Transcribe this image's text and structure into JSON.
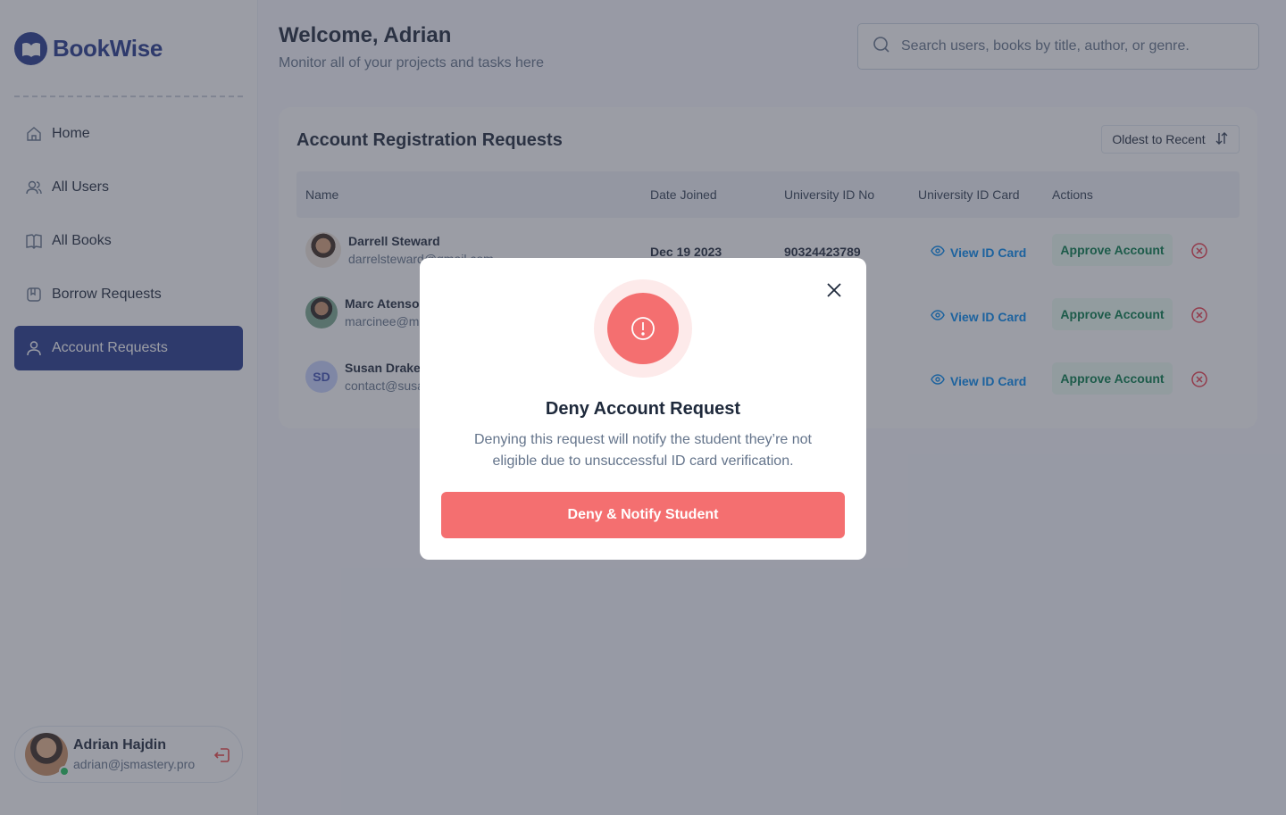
{
  "brand": {
    "name": "BookWise",
    "color": "#25388c"
  },
  "sidebar": {
    "items": [
      {
        "label": "Home",
        "icon": "home-icon"
      },
      {
        "label": "All Users",
        "icon": "users-icon"
      },
      {
        "label": "All Books",
        "icon": "book-icon"
      },
      {
        "label": "Borrow Requests",
        "icon": "bookmark-icon"
      },
      {
        "label": "Account Requests",
        "icon": "user-icon",
        "active": true
      }
    ],
    "user": {
      "name": "Adrian Hajdin",
      "email": "adrian@jsmastery.pro",
      "status": "online"
    }
  },
  "header": {
    "title": "Welcome, Adrian",
    "subtitle": "Monitor all of your projects and tasks here",
    "search_placeholder": "Search users, books by title, author, or genre."
  },
  "panel": {
    "title": "Account Registration Requests",
    "sort_label": "Oldest to Recent",
    "columns": [
      "Name",
      "Date Joined",
      "University ID No",
      "University ID Card",
      "Actions"
    ],
    "rows": [
      {
        "name": "Darrell Steward",
        "email": "darrelsteward@gmail.com",
        "date": "Dec 19 2023",
        "uni_id": "90324423789",
        "view_label": "View ID Card",
        "approve_label": "Approve Account"
      },
      {
        "name": "Marc Atenson",
        "email": "marcinee@mi",
        "view_label": "View ID Card",
        "approve_label": "Approve Account"
      },
      {
        "name": "Susan Drake",
        "email": "contact@susa",
        "initials": "SD",
        "view_label": "View ID Card",
        "approve_label": "Approve Account"
      }
    ]
  },
  "modal": {
    "title": "Deny Account Request",
    "description": "Denying this request will notify the student they’re not eligible due to unsuccessful ID card verification.",
    "action_label": "Deny & Notify Student",
    "accent": "#f46f70"
  }
}
